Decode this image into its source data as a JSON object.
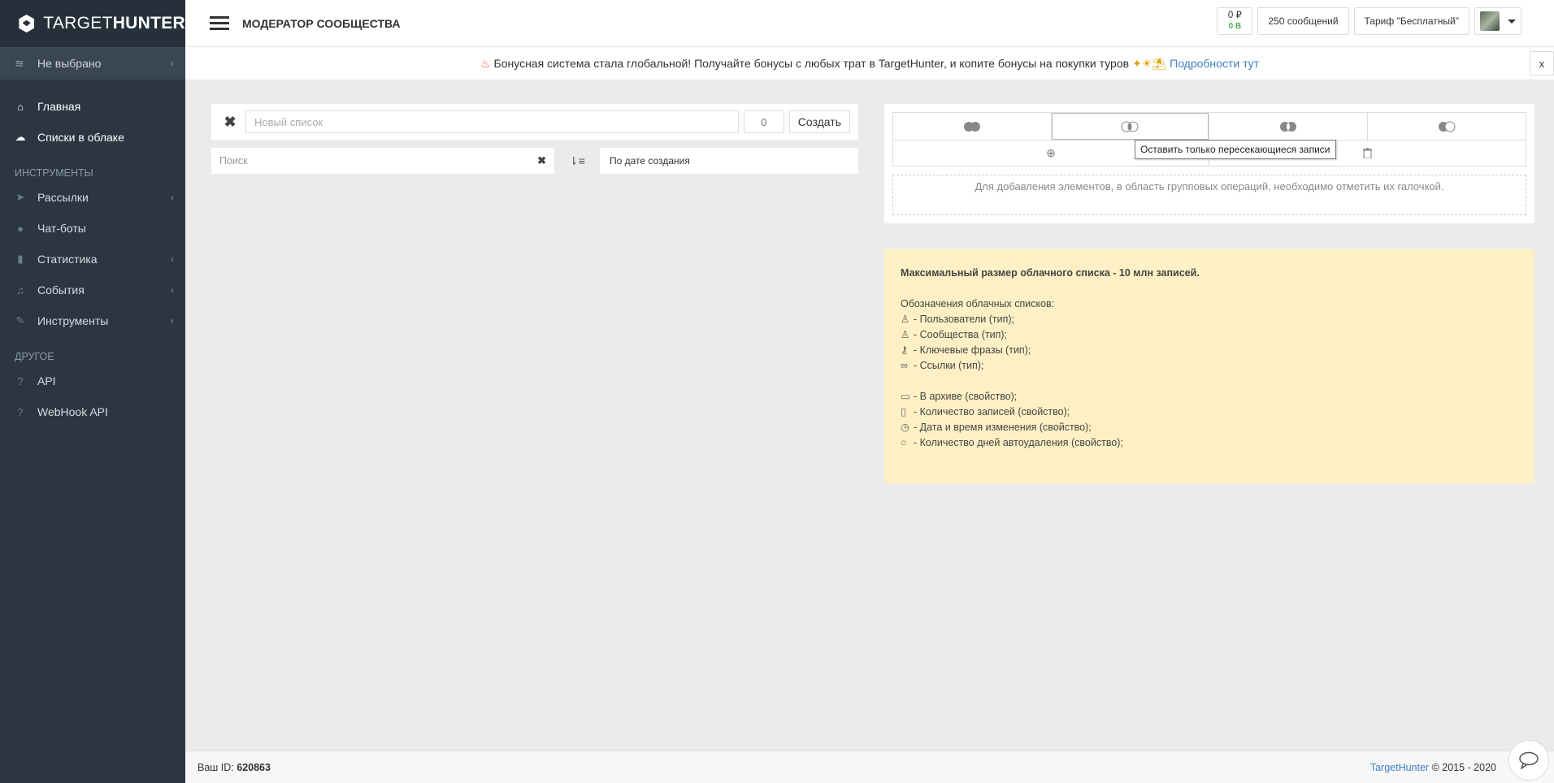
{
  "brand": {
    "name_light": "TARGET",
    "name_bold": "HUNTER"
  },
  "sidebar": {
    "project": "Не выбрано",
    "main_items": [
      {
        "label": "Главная",
        "icon": "home-icon"
      },
      {
        "label": "Списки в облаке",
        "icon": "cloud-upload-icon"
      }
    ],
    "tools_header": "ИНСТРУМЕНТЫ",
    "tools_items": [
      {
        "label": "Рассылки",
        "icon": "paper-plane-icon"
      },
      {
        "label": "Чат-боты",
        "icon": "robot-icon"
      },
      {
        "label": "Статистика",
        "icon": "bar-chart-icon"
      },
      {
        "label": "События",
        "icon": "bell-icon"
      },
      {
        "label": "Инструменты",
        "icon": "wrench-icon"
      }
    ],
    "other_header": "ДРУГОЕ",
    "other_items": [
      {
        "label": "API",
        "icon": "help-circle-icon"
      },
      {
        "label": "WebHook API",
        "icon": "help-circle-icon"
      }
    ]
  },
  "topbar": {
    "title": "МОДЕРАТОР СООБЩЕСТВА",
    "balance_rub": "0 ₽",
    "balance_b": "0 B",
    "messages": "250 сообщений",
    "tariff": "Тариф \"Бесплатный\""
  },
  "banner": {
    "text": "Бонусная система стала глобальной! Получайте бонусы с любых трат в TargetHunter, и копите бонусы на покупки туров",
    "link": "Подробности тут",
    "close": "x"
  },
  "left": {
    "new_list_placeholder": "Новый список",
    "count": "0",
    "create_label": "Создать",
    "search_placeholder": "Поиск",
    "sort_value": "По дате создания"
  },
  "right": {
    "tooltip": "Оставить только пересекающиеся записи",
    "dropzone_text": "Для добавления элементов, в область групповых операций, необходимо отметить их галочкой."
  },
  "info": {
    "headline": "Максимальный размер облачного списка - 10 млн записей.",
    "legend_title": "Обозначения облачных списков:",
    "types": [
      "- Пользователи (тип);",
      "- Сообщества (тип);",
      "- Ключевые фразы (тип);",
      "- Ссылки (тип);"
    ],
    "props": [
      "- В архиве (свойство);",
      "- Количество записей (свойство);",
      "- Дата и время изменения (свойство);",
      "- Количество дней автоудаления (свойство);"
    ]
  },
  "footer": {
    "id_label": "Ваш ID:",
    "id_value": "620863",
    "brand_link": "TargetHunter",
    "copyright": "© 2015 - 2020"
  },
  "colors": {
    "sidebar": "#2b3642",
    "accent_link": "#3f7fc4",
    "info_bg": "#fdf0c4",
    "balance_green": "#4caf50"
  }
}
